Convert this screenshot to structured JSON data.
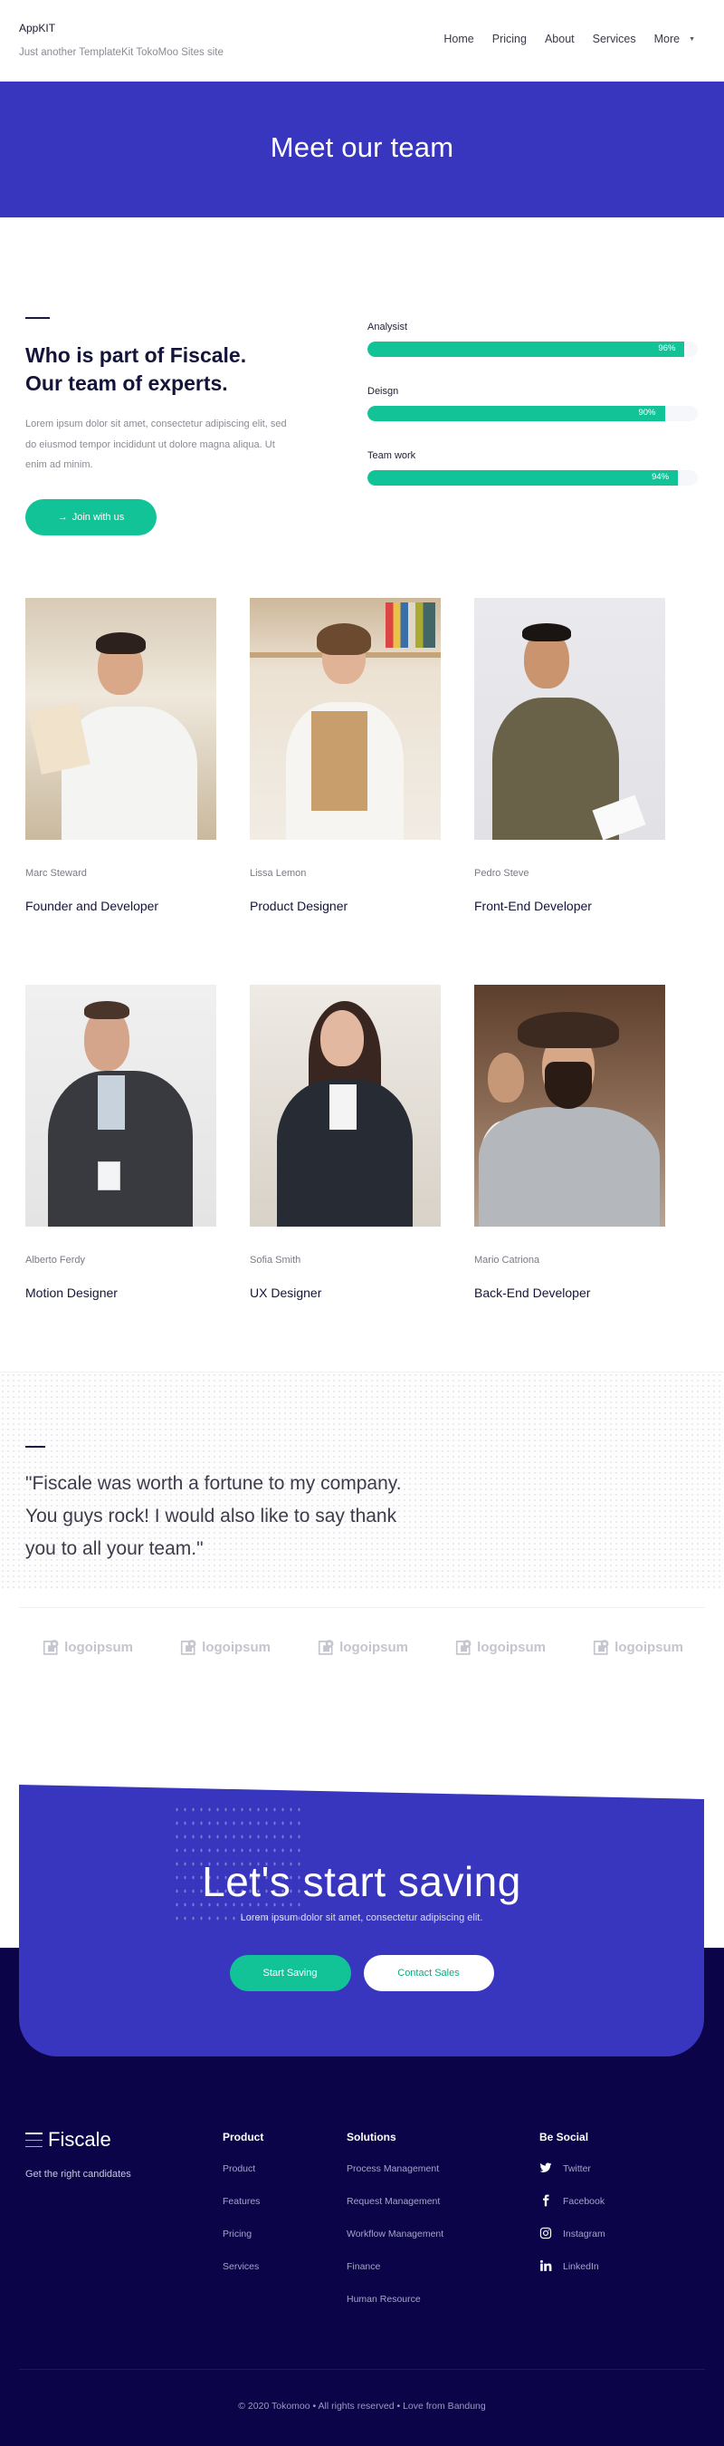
{
  "header": {
    "brand": "AppKIT",
    "tagline": "Just another TemplateKit TokoMoo Sites site",
    "nav": [
      {
        "label": "Home"
      },
      {
        "label": "Pricing"
      },
      {
        "label": "About"
      },
      {
        "label": "Services"
      },
      {
        "label": "More",
        "icon": "caret-down-icon",
        "glyph": "▼"
      }
    ]
  },
  "hero": {
    "title": "Meet our team"
  },
  "about": {
    "title_line1": "Who is part of Fiscale.",
    "title_line2": "Our team of experts.",
    "text": "Lorem ipsum dolor sit amet, consectetur adipiscing elit, sed do eiusmod tempor incididunt ut dolore magna aliqua. Ut enim ad minim.",
    "button_label": "Join with us",
    "button_icon": "→"
  },
  "skills": [
    {
      "label": "Analysist",
      "percent": 96,
      "percent_label": "96%"
    },
    {
      "label": "Deisgn",
      "percent": 90,
      "percent_label": "90%"
    },
    {
      "label": "Team work",
      "percent": 94,
      "percent_label": "94%"
    }
  ],
  "team": [
    {
      "name": "Marc Steward",
      "role": "Founder and Developer"
    },
    {
      "name": "Lissa Lemon",
      "role": "Product Designer"
    },
    {
      "name": "Pedro Steve",
      "role": "Front-End Developer"
    },
    {
      "name": "Alberto Ferdy",
      "role": "Motion Designer"
    },
    {
      "name": "Sofia Smith",
      "role": "UX Designer"
    },
    {
      "name": "Mario Catriona",
      "role": "Back-End Developer"
    }
  ],
  "testimonial": {
    "quote": "\"Fiscale was worth a fortune to my company. You guys rock! I would also like to say thank you to all your team.\""
  },
  "logos": [
    {
      "label": "logoipsum"
    },
    {
      "label": "logoipsum"
    },
    {
      "label": "logoipsum"
    },
    {
      "label": "logoipsum"
    },
    {
      "label": "logoipsum"
    }
  ],
  "cta": {
    "title": "Let's start saving",
    "subtitle": "Lorem ipsum dolor sit amet, consectetur adipiscing elit.",
    "primary_label": "Start Saving",
    "secondary_label": "Contact Sales"
  },
  "footer": {
    "brand": "Fiscale",
    "tagline": "Get the right candidates",
    "columns": [
      {
        "title": "Product",
        "links": [
          "Product",
          "Features",
          "Pricing",
          "Services"
        ]
      },
      {
        "title": "Solutions",
        "links": [
          "Process Management",
          "Request Management",
          "Workflow Management",
          "Finance",
          "Human Resource"
        ]
      }
    ],
    "social": {
      "title": "Be Social",
      "links": [
        {
          "label": "Twitter",
          "icon": "twitter-icon"
        },
        {
          "label": "Facebook",
          "icon": "facebook-icon"
        },
        {
          "label": "Instagram",
          "icon": "instagram-icon"
        },
        {
          "label": "LinkedIn",
          "icon": "linkedin-icon"
        }
      ]
    },
    "copyright": "© 2020 Tokomoo • All rights reserved • Love from Bandung"
  },
  "colors": {
    "primary": "#3835bf",
    "accent": "#12c397",
    "footer_bg": "#0c0448",
    "heading": "#14143a"
  }
}
